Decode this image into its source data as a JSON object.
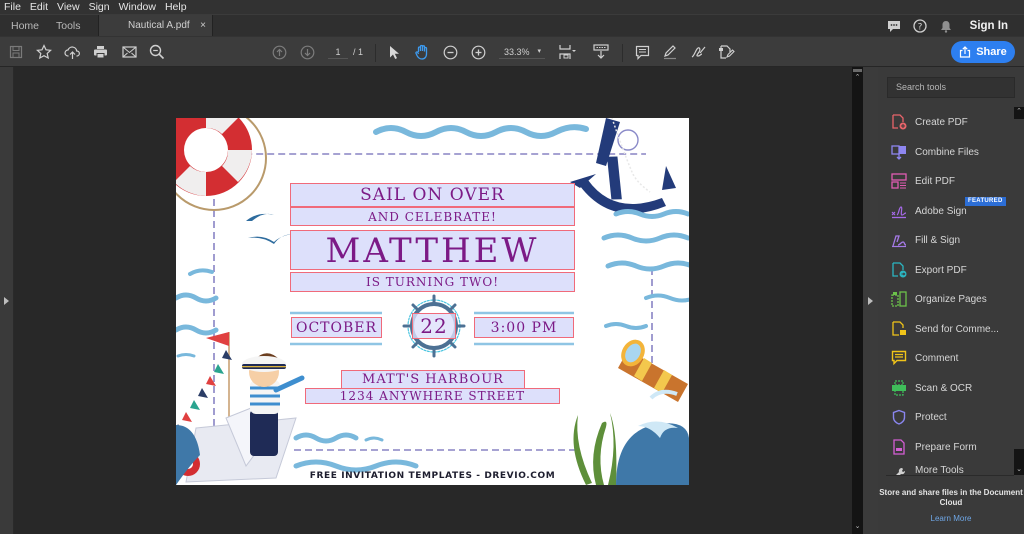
{
  "menu": [
    "File",
    "Edit",
    "View",
    "Sign",
    "Window",
    "Help"
  ],
  "tabs": {
    "home": "Home",
    "tools": "Tools",
    "document": "Nautical A.pdf",
    "close": "×"
  },
  "header_right": {
    "sign_in": "Sign In",
    "icons": [
      "chat-icon",
      "help-icon",
      "notifications-icon"
    ]
  },
  "toolbar": {
    "page_current": "1",
    "page_total": "/ 1",
    "zoom_level": "33.3%",
    "zoom_caret": "▾",
    "share_label": "Share",
    "active_tool": "hand-tool"
  },
  "scroll": {
    "up": "⌃",
    "down": "⌄"
  },
  "document": {
    "line1": "SAIL ON OVER",
    "line2": "AND CELEBRATE!",
    "name": "MATTHEW",
    "line3": "IS TURNING TWO!",
    "month": "OCTOBER",
    "day": "22",
    "time": "3:00 PM",
    "venue": "MATT'S HARBOUR",
    "street": "1234 ANYWHERE STREET",
    "credit": "FREE INVITATION TEMPLATES - DREVIO.COM"
  },
  "tools_panel": {
    "search_placeholder": "Search tools",
    "featured_badge": "FEATURED",
    "items": [
      {
        "label": "Create PDF",
        "color": "#e8646a"
      },
      {
        "label": "Combine Files",
        "color": "#8e86f0"
      },
      {
        "label": "Edit PDF",
        "color": "#e05cb2"
      },
      {
        "label": "Adobe Sign",
        "color": "#a66ae8"
      },
      {
        "label": "Fill & Sign",
        "color": "#a67ae8"
      },
      {
        "label": "Export PDF",
        "color": "#2bb6c2"
      },
      {
        "label": "Organize Pages",
        "color": "#6cc24a"
      },
      {
        "label": "Send for Comme...",
        "color": "#f0c419"
      },
      {
        "label": "Comment",
        "color": "#f0c419"
      },
      {
        "label": "Scan & OCR",
        "color": "#3fbf5a"
      },
      {
        "label": "Protect",
        "color": "#8a86f0"
      },
      {
        "label": "Prepare Form",
        "color": "#d45ed4"
      },
      {
        "label": "More Tools",
        "color": "#cfcfcf"
      }
    ],
    "cloud_text": "Store and share files in the Document Cloud",
    "learn_more": "Learn More"
  },
  "colors": {
    "accent": "#2d7ff0",
    "field_text": "#7c1a86",
    "field_bg": "#dde0fb",
    "field_border": "#f06a7a"
  }
}
